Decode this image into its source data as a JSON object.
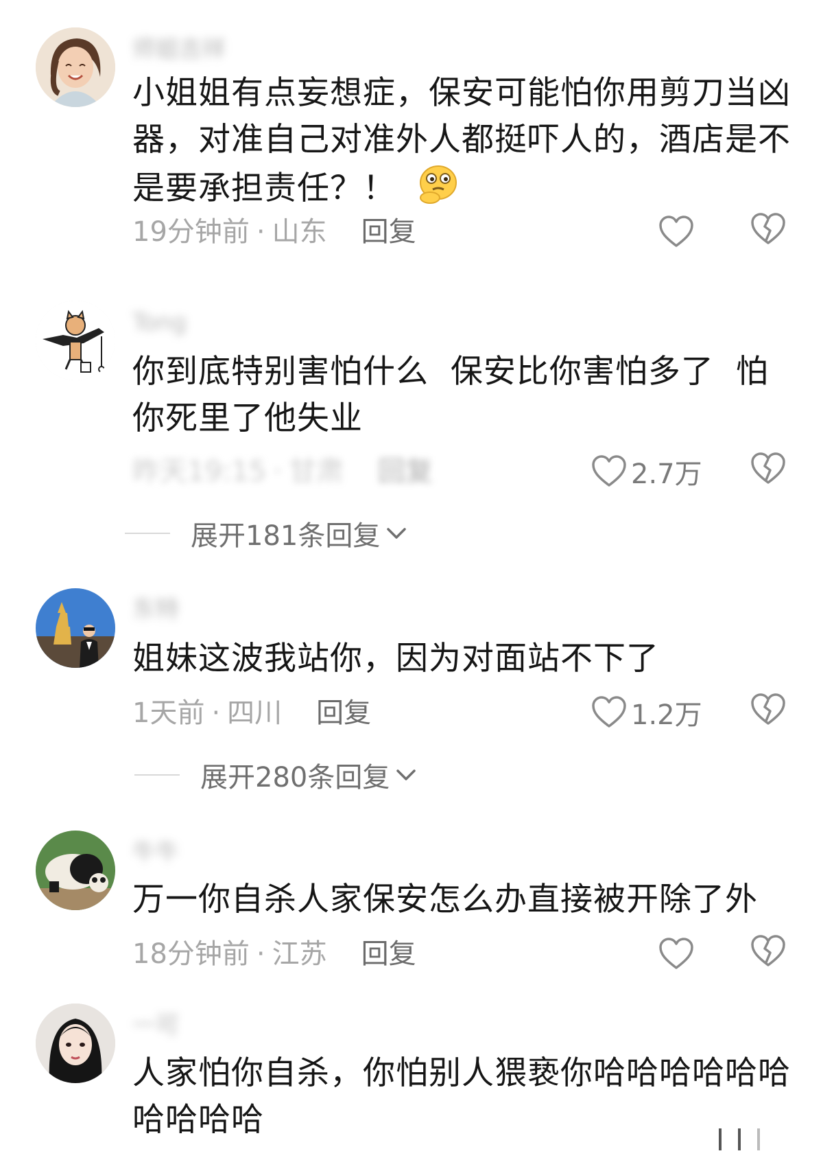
{
  "comments": [
    {
      "username": "师姐吉祥",
      "text": "小姐姐有点妄想症，保安可能怕你用剪刀当凶器，对准自己对准外人都挺吓人的，酒店是不是要承担责任？！",
      "time": "19分钟前",
      "location": "山东",
      "reply_label": "回复",
      "like_count": "",
      "avatar_icon": "avatar-woman-smiling"
    },
    {
      "username": "Tong",
      "text": "你到底特别害怕什么  保安比你害怕多了  怕你死里了他失业",
      "time": "昨天19:15",
      "location": "甘肃",
      "reply_label": "回复",
      "like_count": "2.7万",
      "expand_label": "展开181条回复",
      "avatar_icon": "avatar-cartoon-cat"
    },
    {
      "username": "东特",
      "text": "姐妹这波我站你，因为对面站不下了",
      "time": "1天前",
      "location": "四川",
      "reply_label": "回复",
      "like_count": "1.2万",
      "expand_label": "展开280条回复",
      "avatar_icon": "avatar-man-pagoda"
    },
    {
      "username": "牛牛",
      "text": "万一你自杀人家保安怎么办直接被开除了外",
      "time": "18分钟前",
      "location": "江苏",
      "reply_label": "回复",
      "like_count": "",
      "avatar_icon": "avatar-panda"
    },
    {
      "username": "一可",
      "text": "人家怕你自杀，你怕别人猥亵你哈哈哈哈哈哈哈哈哈哈",
      "avatar_icon": "avatar-woman-portrait"
    }
  ],
  "icons": {
    "like": "heart-outline-icon",
    "dislike": "broken-heart-icon",
    "expand": "chevron-down-icon",
    "emoji": "thinking-face-emoji"
  },
  "colors": {
    "text": "#161616",
    "meta": "#a6a6a6",
    "icon": "#8a8a8a"
  }
}
